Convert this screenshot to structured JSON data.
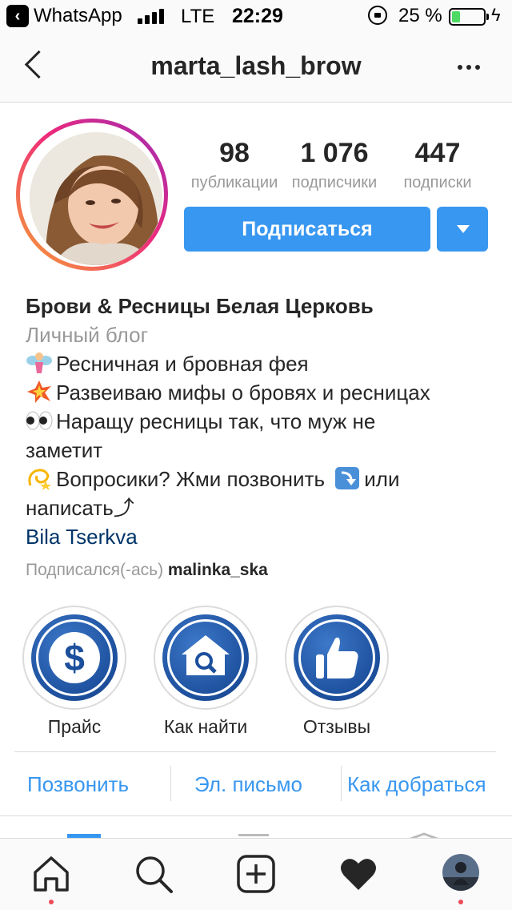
{
  "status_bar": {
    "back_app": "WhatsApp",
    "network": "LTE",
    "time": "22:29",
    "battery_percent": "25 %",
    "battery_level": 0.25
  },
  "nav": {
    "username": "marta_lash_brow"
  },
  "stats": [
    {
      "value": "98",
      "label": "публикации"
    },
    {
      "value": "1 076",
      "label": "подписчики"
    },
    {
      "value": "447",
      "label": "подписки"
    }
  ],
  "actions": {
    "subscribe_label": "Подписаться"
  },
  "bio": {
    "name": "Брови & Ресницы Белая Церковь",
    "category": "Личный блог",
    "lines": [
      "Ресничная и бровная фея",
      "Развеиваю мифы о бровях и ресницах",
      "Наращу ресницы так, что муж не",
      "заметит",
      "Вопросики? Жми позвонить",
      "или",
      "написать⤴"
    ],
    "location": "Bila Tserkva",
    "followed_by_prefix": "Подписался(-ась)",
    "followed_by_user": "malinka_ska"
  },
  "highlights": [
    {
      "label": "Прайс",
      "icon": "dollar-icon"
    },
    {
      "label": "Как найти",
      "icon": "house-search-icon"
    },
    {
      "label": "Отзывы",
      "icon": "thumbs-up-icon"
    }
  ],
  "contacts": {
    "call": "Позвонить",
    "email": "Эл. письмо",
    "directions": "Как добраться"
  },
  "tabbar": [
    {
      "name": "home-icon"
    },
    {
      "name": "search-icon"
    },
    {
      "name": "new-post-icon"
    },
    {
      "name": "activity-heart-icon"
    },
    {
      "name": "profile-avatar"
    }
  ],
  "colors": {
    "accent": "#3897f0",
    "link": "#003569",
    "muted": "#999999",
    "notification_dot": "#ed4956"
  }
}
